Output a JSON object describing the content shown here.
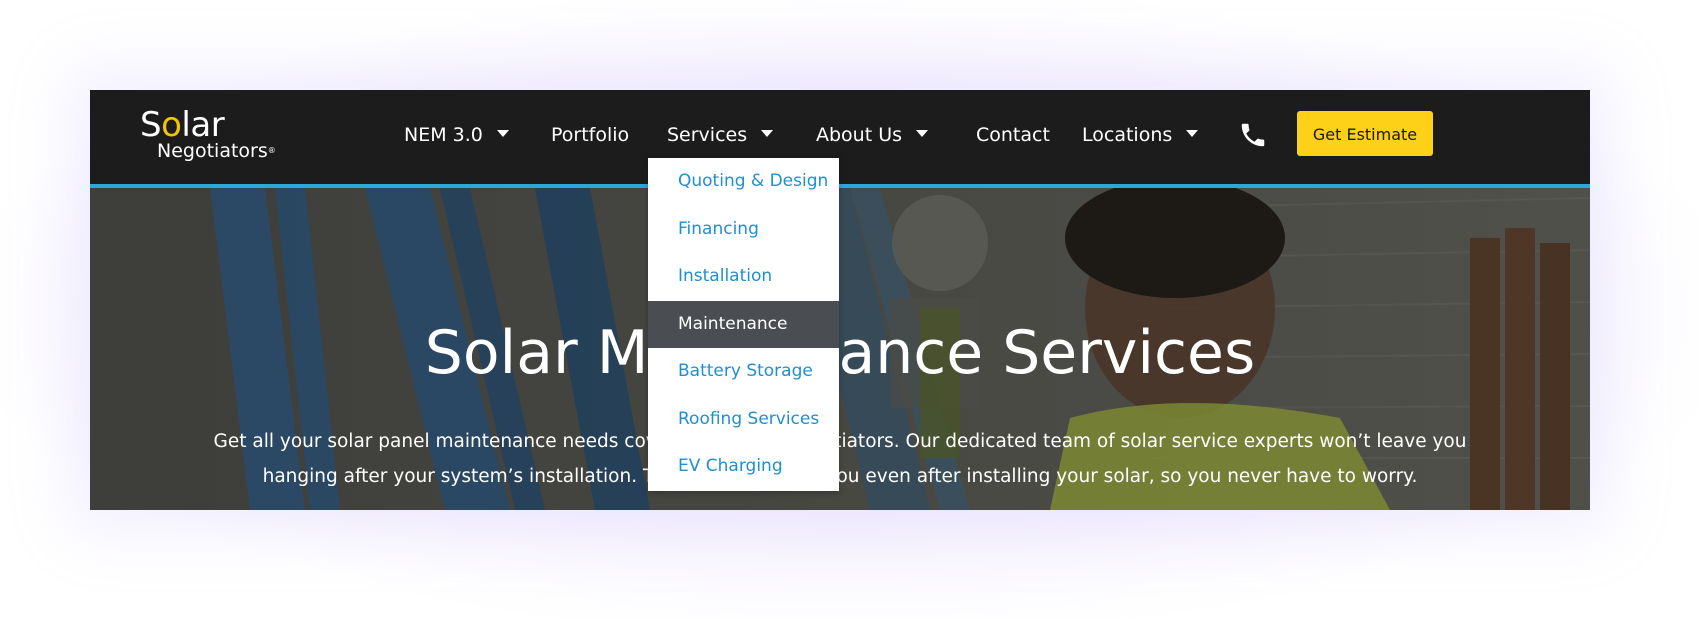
{
  "colors": {
    "nav_bg": "#1c1c1c",
    "accent_line": "#2aa9d8",
    "cta_bg": "#fcd117",
    "dropdown_link": "#1f8fd1",
    "dropdown_active_bg": "#4a4d52",
    "logo_sun": "#f5c400"
  },
  "logo": {
    "top_text_1": "S",
    "top_text_sun": "o",
    "top_text_2": "lar",
    "bottom_text": "Negotiators",
    "reg": "®"
  },
  "nav": {
    "items": [
      {
        "label": "NEM 3.0",
        "has_caret": true
      },
      {
        "label": "Portfolio",
        "has_caret": false
      },
      {
        "label": "Services",
        "has_caret": true
      },
      {
        "label": "About Us",
        "has_caret": true
      },
      {
        "label": "Contact",
        "has_caret": false
      },
      {
        "label": "Locations",
        "has_caret": true
      }
    ],
    "phone_icon": "phone-icon",
    "cta_label": "Get Estimate"
  },
  "dropdown": {
    "items": [
      {
        "label": "Quoting & Design"
      },
      {
        "label": "Financing"
      },
      {
        "label": "Installation"
      },
      {
        "label": "Maintenance",
        "active": true
      },
      {
        "label": "Battery Storage"
      },
      {
        "label": "Roofing Services"
      },
      {
        "label": "EV Charging"
      }
    ]
  },
  "hero": {
    "title": "Solar Maintenance Services",
    "text": "Get all your solar panel maintenance needs covered by Solar Negotiators. Our dedicated team of solar service experts won’t leave you hanging after your system’s installation. They’ll be there for you even after installing your solar, so you never have to worry."
  }
}
